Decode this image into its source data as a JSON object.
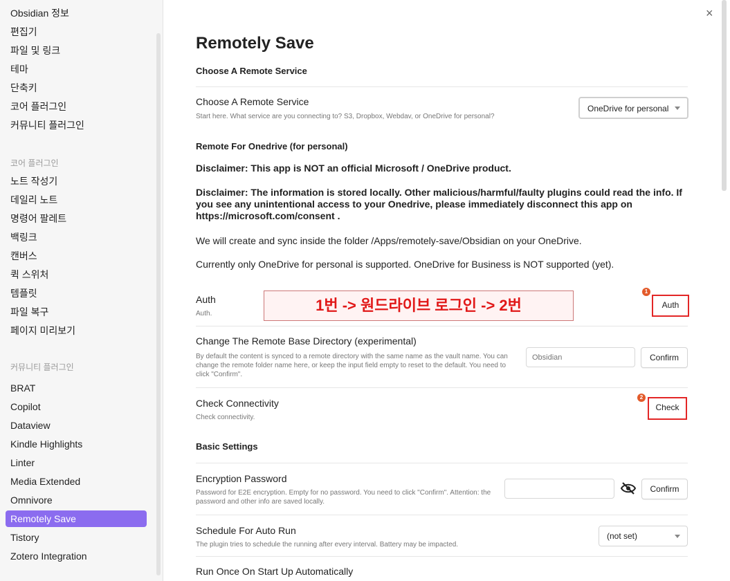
{
  "sidebar": {
    "general": [
      "Obsidian 정보",
      "편집기",
      "파일 및 링크",
      "테마",
      "단축키",
      "코어 플러그인",
      "커뮤니티 플러그인"
    ],
    "core_heading": "코어 플러그인",
    "core": [
      "노트 작성기",
      "데일리 노트",
      "명령어 팔레트",
      "백링크",
      "캔버스",
      "퀵 스위처",
      "템플릿",
      "파일 복구",
      "페이지 미리보기"
    ],
    "community_heading": "커뮤니티 플러그인",
    "community": [
      "BRAT",
      "Copilot",
      "Dataview",
      "Kindle Highlights",
      "Linter",
      "Media Extended",
      "Omnivore",
      "Remotely Save",
      "Tistory",
      "Zotero Integration"
    ],
    "active_item": "Remotely Save",
    "accent_color": "#8b6cef"
  },
  "close_icon": "×",
  "main": {
    "title": "Remotely Save",
    "section_choose": "Choose A Remote Service",
    "choose_name": "Choose A Remote Service",
    "choose_desc": "Start here. What service are you connecting to? S3, Dropbox, Webdav, or OneDrive for personal?",
    "choose_value": "OneDrive for personal",
    "remote_heading": "Remote For Onedrive (for personal)",
    "disclaimer1": "Disclaimer: This app is NOT an official Microsoft / OneDrive product.",
    "disclaimer2": "Disclaimer: The information is stored locally. Other malicious/harmful/faulty plugins could read the info. If you see any unintentional access to your Onedrive, please immediately disconnect this app on https://microsoft.com/consent .",
    "info1": "We will create and sync inside the folder /Apps/remotely-save/Obsidian on your OneDrive.",
    "info2": "Currently only OneDrive for personal is supported. OneDrive for Business is NOT supported (yet).",
    "auth_name": "Auth",
    "auth_desc": "Auth.",
    "auth_button": "Auth",
    "badge1": "1",
    "annotation": "1번 -> 원드라이브 로그인 -> 2번",
    "annotation_color": "#e11818",
    "base_dir_name": "Change The Remote Base Directory (experimental)",
    "base_dir_desc": "By default the content is synced to a remote directory with the same name as the vault name. You can change the remote folder name here, or keep the input field empty to reset to the default. You need to click \"Confirm\".",
    "base_dir_placeholder": "Obsidian",
    "confirm_label": "Confirm",
    "check_name": "Check Connectivity",
    "check_desc": "Check connectivity.",
    "check_button": "Check",
    "badge2": "2",
    "basic_heading": "Basic Settings",
    "enc_name": "Encryption Password",
    "enc_desc": "Password for E2E encryption. Empty for no password. You need to click \"Confirm\". Attention: the password and other info are saved locally.",
    "eye_icon": "eye-slash-icon",
    "schedule_name": "Schedule For Auto Run",
    "schedule_desc": "The plugin tries to schedule the running after every interval. Battery may be impacted.",
    "schedule_value": "(not set)",
    "runonce_name": "Run Once On Start Up Automatically"
  }
}
